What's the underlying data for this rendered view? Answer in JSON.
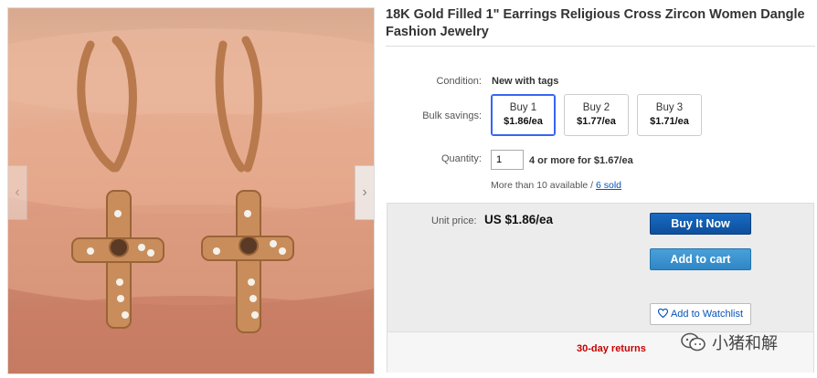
{
  "product": {
    "title": "18K Gold Filled 1\" Earrings Religious Cross Zircon Women Dangle Fashion Jewelry"
  },
  "gallery": {
    "prev_icon": "chevron-left-icon",
    "prev_glyph": "‹",
    "next_icon": "chevron-right-icon",
    "next_glyph": "›"
  },
  "condition": {
    "label": "Condition:",
    "value": "New with tags"
  },
  "bulk": {
    "label": "Bulk savings:",
    "options": [
      {
        "qty": "Buy 1",
        "price": "$1.86/ea",
        "selected": true
      },
      {
        "qty": "Buy 2",
        "price": "$1.77/ea",
        "selected": false
      },
      {
        "qty": "Buy 3",
        "price": "$1.71/ea",
        "selected": false
      }
    ]
  },
  "quantity": {
    "label": "Quantity:",
    "value": "1",
    "offer": "4 or more for $1.67/ea",
    "available": "More than 10 available / ",
    "sold_link": "6 sold"
  },
  "purchase": {
    "unit_price_label": "Unit price:",
    "unit_price": "US $1.86/ea",
    "buy_now": "Buy It Now",
    "add_to_cart": "Add to cart",
    "watchlist": "Add to Watchlist",
    "watchlist_icon": "heart-icon",
    "returns": "30-day returns"
  },
  "watermark": {
    "text": "小猪和解",
    "icon": "wechat-icon"
  },
  "colors": {
    "buy_now": "#0d4f9c",
    "add_to_cart": "#2f86c5",
    "link": "#0654ba",
    "returns": "#c60000",
    "selected_border": "#3665f3"
  }
}
